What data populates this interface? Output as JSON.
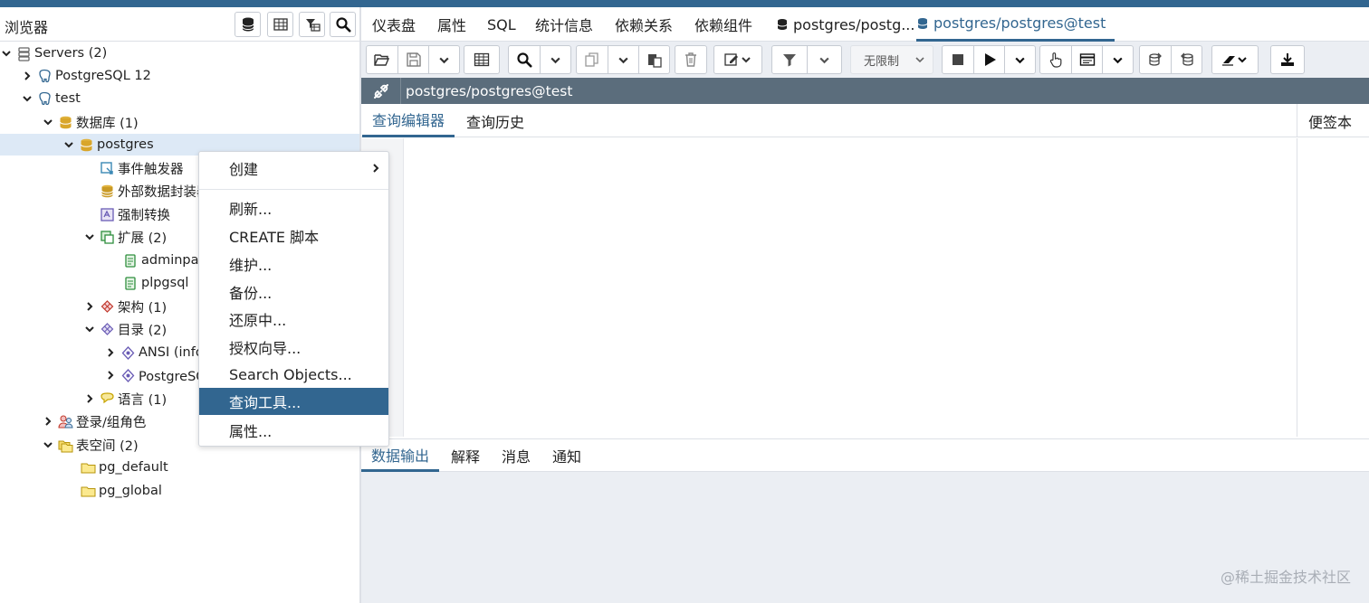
{
  "browser": {
    "title": "浏览器",
    "tree": [
      {
        "label": "Servers (2)",
        "icon": "servers-icon",
        "indent": 0,
        "chevron": "down"
      },
      {
        "label": "PostgreSQL 12",
        "icon": "elephant-icon",
        "indent": 1,
        "chevron": "right"
      },
      {
        "label": "test",
        "icon": "elephant-icon",
        "indent": 1,
        "chevron": "down"
      },
      {
        "label": "数据库 (1)",
        "icon": "databases-icon",
        "indent": 2,
        "chevron": "down"
      },
      {
        "label": "postgres",
        "icon": "database-icon",
        "indent": 3,
        "chevron": "down",
        "selected": true
      },
      {
        "label": "事件触发器",
        "icon": "event-trigger-icon",
        "indent": 4,
        "chevron": "none"
      },
      {
        "label": "外部数据封装器",
        "icon": "foreign-data-icon",
        "indent": 4,
        "chevron": "none"
      },
      {
        "label": "强制转换",
        "icon": "cast-icon",
        "indent": 4,
        "chevron": "none"
      },
      {
        "label": "扩展 (2)",
        "icon": "extension-icon",
        "indent": 4,
        "chevron": "down"
      },
      {
        "label": "adminpack",
        "icon": "extension-item-icon",
        "indent": 5,
        "chevron": "none"
      },
      {
        "label": "plpgsql",
        "icon": "extension-item-icon",
        "indent": 5,
        "chevron": "none"
      },
      {
        "label": "架构 (1)",
        "icon": "schema-icon",
        "indent": 4,
        "chevron": "right"
      },
      {
        "label": "目录 (2)",
        "icon": "catalog-icon",
        "indent": 4,
        "chevron": "down"
      },
      {
        "label": "ANSI (information_schema)",
        "icon": "catalog-item-icon",
        "indent": 5,
        "chevron": "right"
      },
      {
        "label": "PostgreSQL 目录 (pg_catalog)",
        "icon": "catalog-item-icon",
        "indent": 5,
        "chevron": "right"
      },
      {
        "label": "语言 (1)",
        "icon": "language-icon",
        "indent": 4,
        "chevron": "right"
      },
      {
        "label": "登录/组角色",
        "icon": "roles-icon",
        "indent": 2,
        "chevron": "right"
      },
      {
        "label": "表空间 (2)",
        "icon": "tablespaces-icon",
        "indent": 2,
        "chevron": "down"
      },
      {
        "label": "pg_default",
        "icon": "folder-icon",
        "indent": 3,
        "chevron": "none"
      },
      {
        "label": "pg_global",
        "icon": "folder-icon",
        "indent": 3,
        "chevron": "none"
      }
    ]
  },
  "top_tabs": [
    {
      "label": "仪表盘"
    },
    {
      "label": "属性"
    },
    {
      "label": "SQL"
    },
    {
      "label": "统计信息"
    },
    {
      "label": "依赖关系"
    },
    {
      "label": "依赖组件"
    },
    {
      "label": "postgres/postg..."
    },
    {
      "label": "postgres/postgres@test",
      "active": true
    }
  ],
  "toolbar": {
    "limit_label": "无限制"
  },
  "connection": {
    "label": "postgres/postgres@test"
  },
  "editor_tabs": [
    {
      "label": "查询编辑器",
      "active": true
    },
    {
      "label": "查询历史"
    }
  ],
  "notepad": {
    "label": "便签本"
  },
  "output_tabs": [
    {
      "label": "数据输出",
      "active": true
    },
    {
      "label": "解释"
    },
    {
      "label": "消息"
    },
    {
      "label": "通知"
    }
  ],
  "context_menu": {
    "items": [
      {
        "label": "创建",
        "submenu": true
      },
      {
        "label": "刷新..."
      },
      {
        "label": "CREATE 脚本"
      },
      {
        "label": "维护..."
      },
      {
        "label": "备份..."
      },
      {
        "label": "还原中..."
      },
      {
        "label": "授权向导..."
      },
      {
        "label": "Search Objects..."
      },
      {
        "label": "查询工具...",
        "highlight": true
      },
      {
        "label": "属性..."
      }
    ]
  },
  "watermark": "@稀土掘金技术社区",
  "colors": {
    "accent": "#326690",
    "connection_bar": "#5b6d7c",
    "toolbar_bg": "#ebeef3",
    "selection": "#dde9f6"
  }
}
